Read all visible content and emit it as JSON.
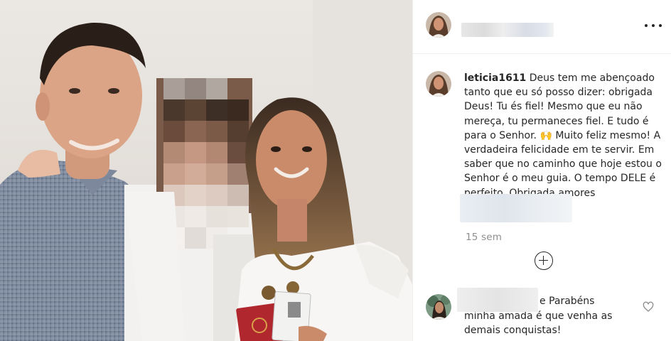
{
  "post": {
    "photo_alt": "",
    "menu_icon": "more-options-icon"
  },
  "caption": {
    "username": "leticia1611",
    "text": "Deus tem me abençoado tanto que eu só posso dizer: obrigada Deus! Tu és fiel! Mesmo que eu não mereça, tu permaneces fiel. E tudo é para o Senhor. 🙌 Muito feliz mesmo! A verdadeira felicidade em te servir. Em saber que no caminho que hoje estou o Senhor é o meu guia. O tempo DELE é perfeito. Obrigada amores",
    "time": "15 sem"
  },
  "comments": [
    {
      "text": "e Parabéns minha amada é que venha as demais conquistas!"
    }
  ],
  "icons": {
    "load_more": "plus-circle-icon",
    "like": "heart-icon"
  }
}
